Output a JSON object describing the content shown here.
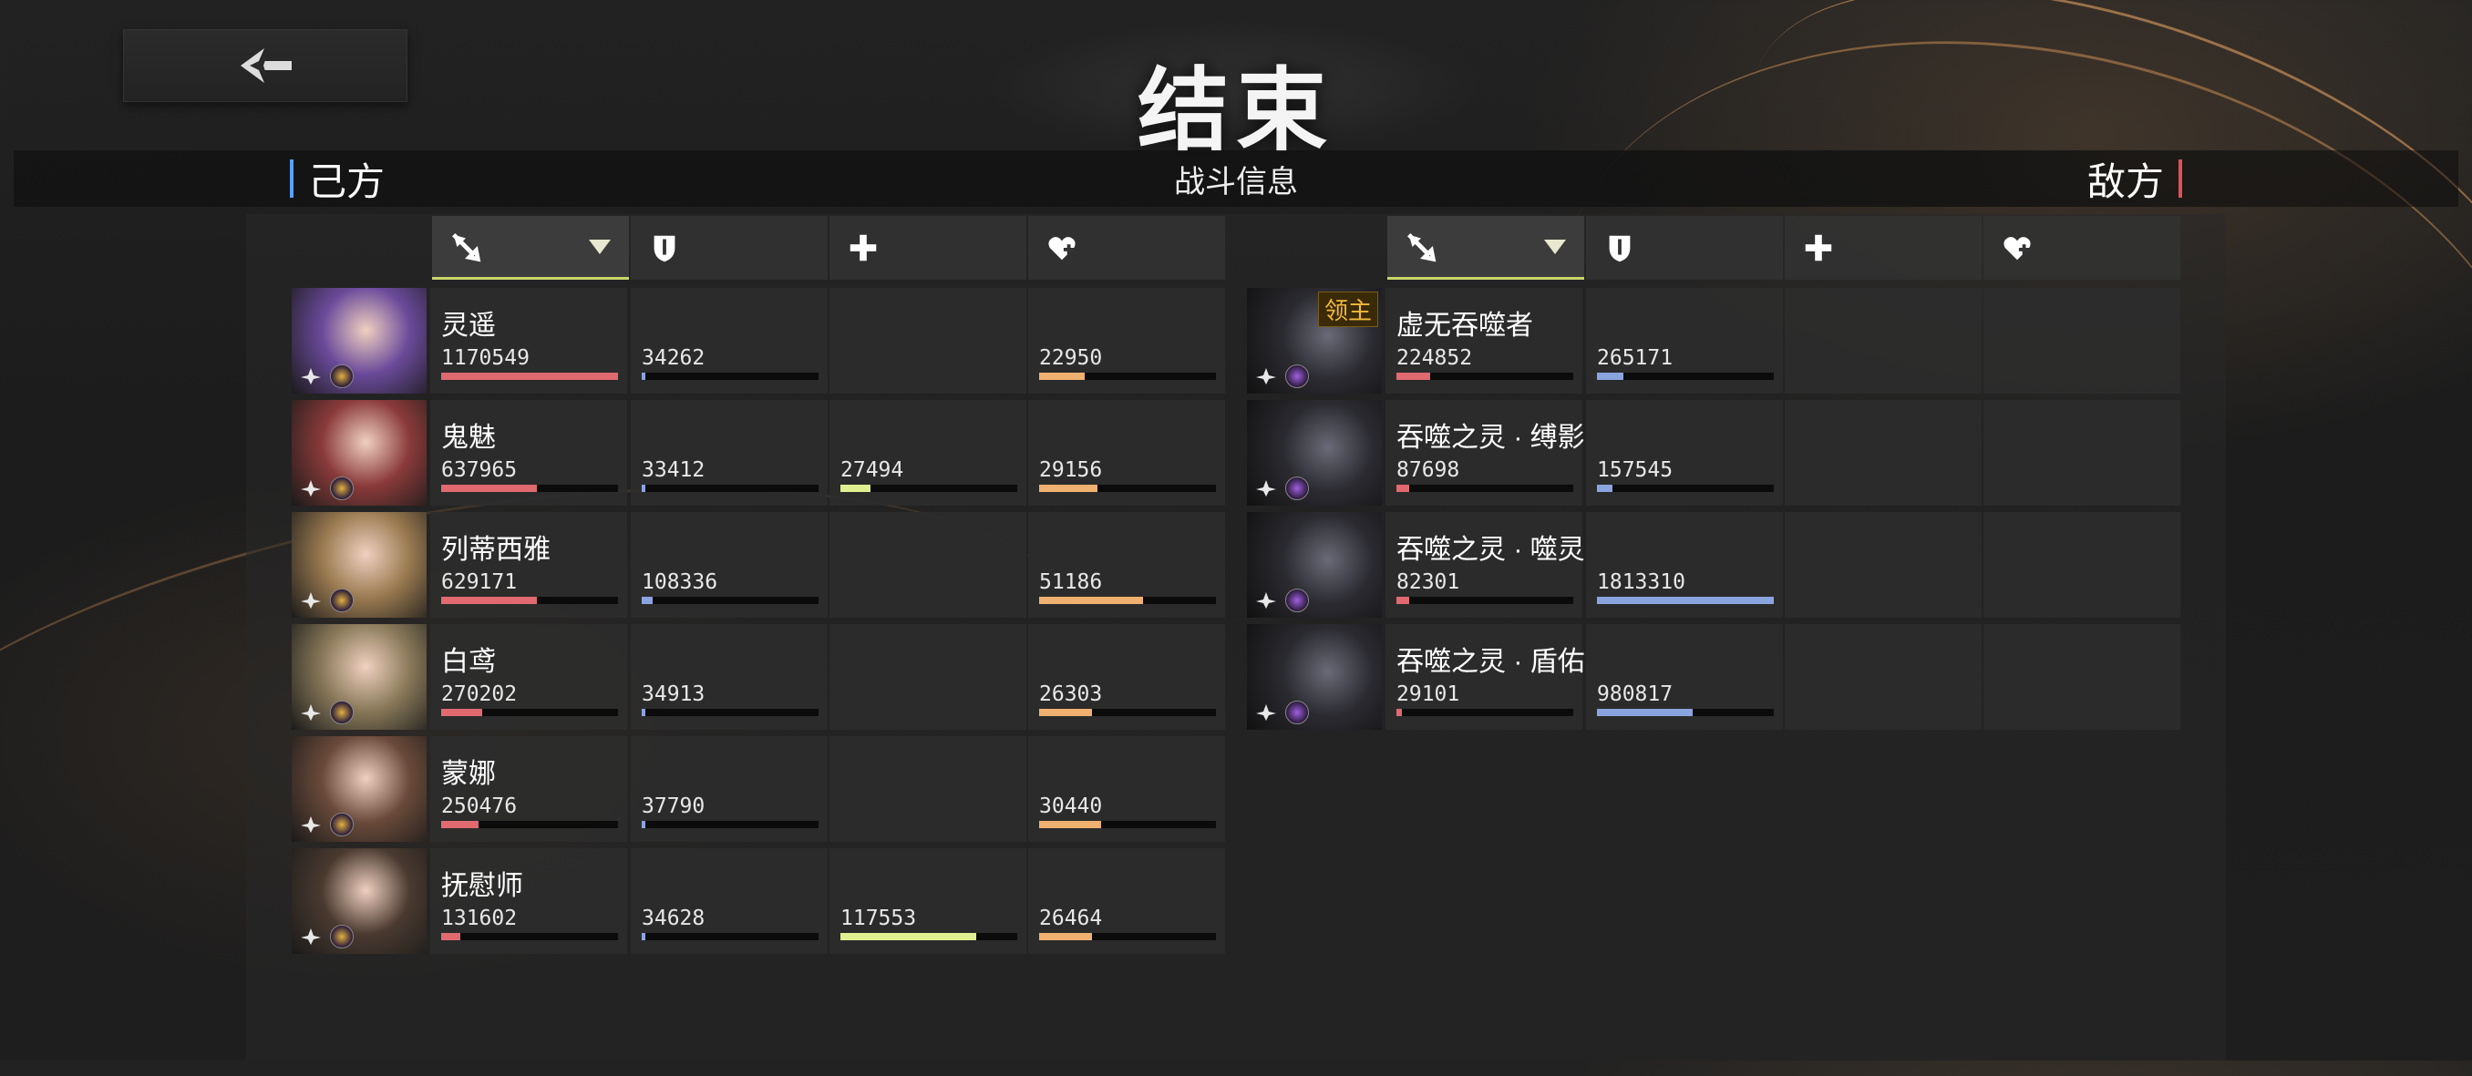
{
  "header": {
    "title": "结束",
    "subtitle": "战斗信息",
    "left_side": "己方",
    "right_side": "敌方"
  },
  "colors": {
    "damage": "#e06a70",
    "defense": "#8aa4e0",
    "heal": "#e0f090",
    "taken": "#f0b070",
    "active_underline": "#c9d66a"
  },
  "columns": [
    {
      "icon": "sword-icon",
      "sorted": true
    },
    {
      "icon": "shield-icon",
      "sorted": false
    },
    {
      "icon": "plus-icon",
      "sorted": false
    },
    {
      "icon": "heart-plus-icon",
      "sorted": false
    }
  ],
  "allies": [
    {
      "name": "灵遥",
      "dmg": "1170549",
      "def": "34262",
      "heal": "",
      "taken": "22950",
      "dmg_frac": 1.0,
      "def_frac": 0.02,
      "heal_frac": 0,
      "taken_frac": 0.26,
      "avatar": "#6a4a9a"
    },
    {
      "name": "鬼魅",
      "dmg": "637965",
      "def": "33412",
      "heal": "27494",
      "taken": "29156",
      "dmg_frac": 0.54,
      "def_frac": 0.02,
      "heal_frac": 0.17,
      "taken_frac": 0.33,
      "avatar": "#8a3a3a"
    },
    {
      "name": "列蒂西雅",
      "dmg": "629171",
      "def": "108336",
      "heal": "",
      "taken": "51186",
      "dmg_frac": 0.54,
      "def_frac": 0.06,
      "heal_frac": 0,
      "taken_frac": 0.59,
      "avatar": "#9a7a50"
    },
    {
      "name": "白鸢",
      "dmg": "270202",
      "def": "34913",
      "heal": "",
      "taken": "26303",
      "dmg_frac": 0.23,
      "def_frac": 0.02,
      "heal_frac": 0,
      "taken_frac": 0.3,
      "avatar": "#8a7a5a"
    },
    {
      "name": "蒙娜",
      "dmg": "250476",
      "def": "37790",
      "heal": "",
      "taken": "30440",
      "dmg_frac": 0.21,
      "def_frac": 0.02,
      "heal_frac": 0,
      "taken_frac": 0.35,
      "avatar": "#6a4a3a"
    },
    {
      "name": "抚慰师",
      "dmg": "131602",
      "def": "34628",
      "heal": "117553",
      "taken": "26464",
      "dmg_frac": 0.11,
      "def_frac": 0.02,
      "heal_frac": 0.77,
      "taken_frac": 0.3,
      "avatar": "#4a3a30"
    }
  ],
  "enemies": [
    {
      "name": "虚无吞噬者",
      "badge": "领主",
      "dmg": "224852",
      "def": "265171",
      "dmg_frac": 0.19,
      "def_frac": 0.15
    },
    {
      "name": "吞噬之灵 · 缚影",
      "badge": "",
      "dmg": "87698",
      "def": "157545",
      "dmg_frac": 0.07,
      "def_frac": 0.09
    },
    {
      "name": "吞噬之灵 · 噬灵",
      "badge": "",
      "dmg": "82301",
      "def": "1813310",
      "dmg_frac": 0.07,
      "def_frac": 1.0
    },
    {
      "name": "吞噬之灵 · 盾佑",
      "badge": "",
      "dmg": "29101",
      "def": "980817",
      "dmg_frac": 0.03,
      "def_frac": 0.54
    }
  ]
}
